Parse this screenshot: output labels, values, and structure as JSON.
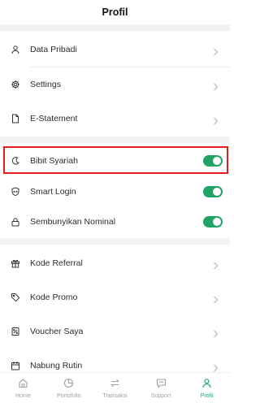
{
  "header": {
    "title": "Profil"
  },
  "section1": [
    {
      "label": "Data Pribadi",
      "icon": "person-icon"
    },
    {
      "label": "Settings",
      "icon": "gear-icon"
    },
    {
      "label": "E-Statement",
      "icon": "document-icon"
    }
  ],
  "section2": [
    {
      "label": "Bibit Syariah",
      "icon": "crescent-moon-icon",
      "enabled": true
    },
    {
      "label": "Smart Login",
      "icon": "shield-icon",
      "enabled": true
    },
    {
      "label": "Sembunyikan Nominal",
      "icon": "lock-icon",
      "enabled": true
    }
  ],
  "section3": [
    {
      "label": "Kode Referral",
      "icon": "gift-icon"
    },
    {
      "label": "Kode Promo",
      "icon": "tag-icon"
    },
    {
      "label": "Voucher Saya",
      "icon": "voucher-icon"
    },
    {
      "label": "Nabung Rutin",
      "icon": "calendar-icon"
    }
  ],
  "tabs": [
    {
      "label": "Home",
      "icon": "home-icon",
      "active": false
    },
    {
      "label": "Portofolio",
      "icon": "pie-chart-icon",
      "active": false
    },
    {
      "label": "Transaksi",
      "icon": "transfer-arrows-icon",
      "active": false
    },
    {
      "label": "Support",
      "icon": "chat-bubble-icon",
      "active": false
    },
    {
      "label": "Profil",
      "icon": "person-icon",
      "active": true
    }
  ],
  "colors": {
    "accent": "#1fa463",
    "highlight": "#e21b1b",
    "inactive": "#a0a0a0",
    "section_gap": "#f2f2f2"
  }
}
